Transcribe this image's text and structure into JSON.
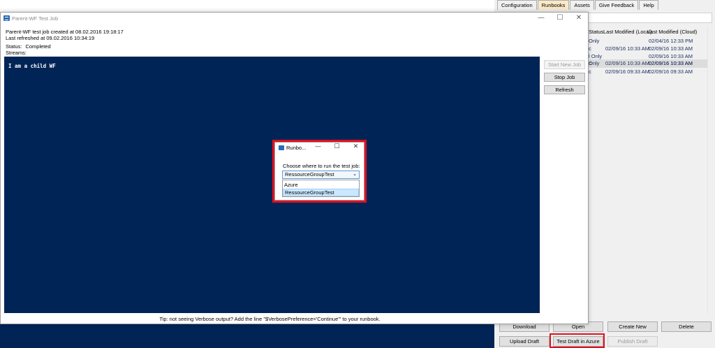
{
  "right_panel": {
    "tabs": [
      {
        "label": "Configuration",
        "active": false
      },
      {
        "label": "Runbooks",
        "active": true
      },
      {
        "label": "Assets",
        "active": false
      },
      {
        "label": "Give Feedback",
        "active": false
      },
      {
        "label": "Help",
        "active": false
      }
    ],
    "columns": {
      "status": "Status",
      "modified_local": "Last Modified (Local)",
      "modified_cloud": "Last Modified (Cloud)"
    },
    "rows": [
      {
        "status": "Only",
        "local": "",
        "cloud": "02/04/16 12:33 PM"
      },
      {
        "status": "c",
        "local": "02/09/16 10:33 AM",
        "cloud": "02/09/16 10:33 AM"
      },
      {
        "status": "l Only",
        "local": "",
        "cloud": "02/09/16 10:33 AM"
      },
      {
        "status": "Only",
        "local": "",
        "cloud": "02/09/16 10:33 AM"
      },
      {
        "status": "c",
        "local": "02/09/16 10:33 AM",
        "cloud": "02/09/16 10:33 AM"
      },
      {
        "status": "c",
        "local": "02/09/16 09:33 AM",
        "cloud": "02/09/16 09:33 AM"
      }
    ],
    "buttons": {
      "download": "Download",
      "open": "Open",
      "create_new": "Create New",
      "delete": "Delete",
      "upload_draft": "Upload Draft",
      "test_draft": "Test Draft in Azure",
      "publish_draft": "Publish Draft"
    }
  },
  "job_window": {
    "title": "Parent-WF Test Job",
    "created": "Parent-WF test job created at 08.02.2016 19:18:17",
    "refreshed": "Last refreshed at 09.02.2016 10:34:19",
    "status_label": "Status:",
    "status_value": "Completed",
    "streams_label": "Streams:",
    "console_output": "I am a child WF",
    "buttons": {
      "start": "Start New Job",
      "stop": "Stop Job",
      "refresh": "Refresh"
    },
    "tip": "Tip: not seeing Verbose output? Add the line \"$VerbosePreference='Continue'\" to your runbook."
  },
  "dialog": {
    "title": "Runbo...",
    "prompt": "Choose where to run the test job:",
    "selected": "RessourceGroupTest",
    "options": [
      "Azure",
      "RessourceGroupTest"
    ]
  },
  "icons": {
    "minimize": "minimize-icon",
    "maximize": "maximize-icon",
    "close": "close-icon",
    "dropdown": "chevron-down-icon",
    "app": "app-icon"
  },
  "colors": {
    "console_bg": "#012456",
    "highlight_red": "#e0101f",
    "active_tab": "#fbe9c6",
    "selection": "#cce8ff"
  }
}
